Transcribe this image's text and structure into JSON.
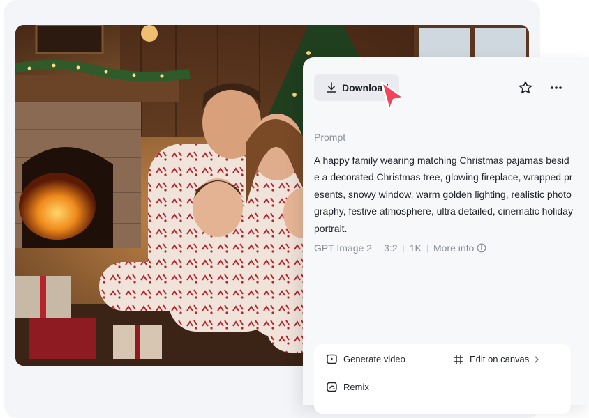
{
  "toolbar": {
    "download_label": "Download",
    "star_icon": "star-icon",
    "more_icon": "more-horizontal-icon"
  },
  "prompt": {
    "label": "Prompt",
    "text": "A happy family wearing matching Christmas pajamas beside a decorated Christmas tree, glowing fireplace, wrapped presents, snowy window, warm golden lighting, realistic photography, festive atmosphere, ultra detailed, cinematic holiday portrait."
  },
  "meta": {
    "model": "GPT Image 2",
    "ratio": "3:2",
    "resolution": "1K",
    "more_info": "More info"
  },
  "actions": {
    "generate_video": "Generate video",
    "edit_on_canvas": "Edit on canvas",
    "remix": "Remix"
  },
  "colors": {
    "accent_cursor": "#f0455a",
    "panel_bg": "#f7f8fa",
    "button_bg": "#e9ebef",
    "muted_text": "#8a8f99"
  }
}
